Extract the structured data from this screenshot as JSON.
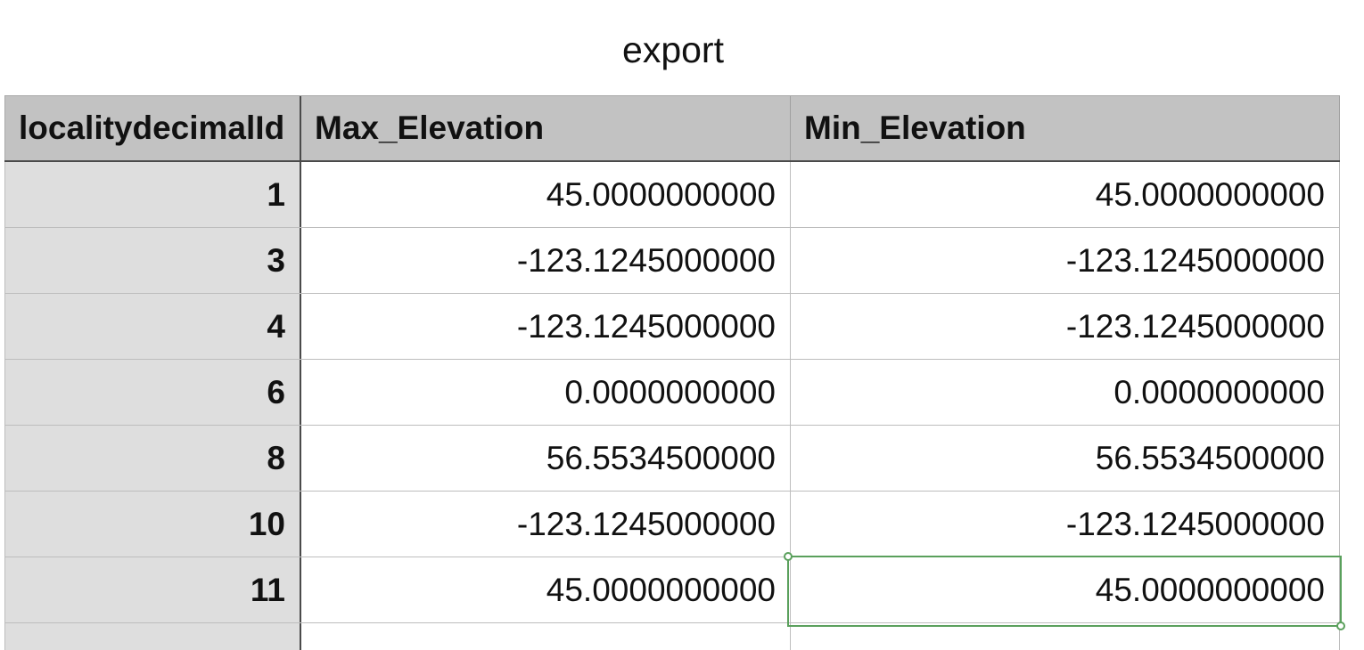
{
  "sheet": {
    "title": "export"
  },
  "table": {
    "headers": [
      "localitydecimalId",
      "Max_Elevation",
      "Min_Elevation"
    ],
    "rows": [
      [
        "1",
        "45.0000000000",
        "45.0000000000"
      ],
      [
        "3",
        "-123.1245000000",
        "-123.1245000000"
      ],
      [
        "4",
        "-123.1245000000",
        "-123.1245000000"
      ],
      [
        "6",
        "0.0000000000",
        "0.0000000000"
      ],
      [
        "8",
        "56.5534500000",
        "56.5534500000"
      ],
      [
        "10",
        "-123.1245000000",
        "-123.1245000000"
      ],
      [
        "11",
        "45.0000000000",
        "45.0000000000"
      ]
    ]
  },
  "colors": {
    "header_bg": "#c2c2c2",
    "row_header_bg": "#dedede",
    "selection": "#5aa05c"
  }
}
